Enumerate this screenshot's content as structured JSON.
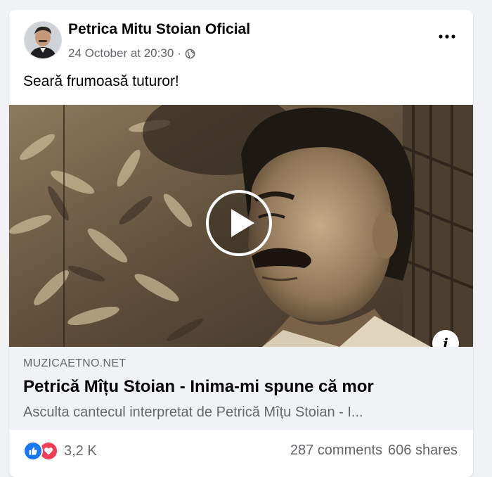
{
  "post": {
    "author": "Petrica Mitu Stoian Oficial",
    "timestamp": "24 October at 20:30",
    "separator": "·",
    "privacy_icon": "globe-icon",
    "more_icon": "more-horizontal-icon",
    "text": "Seară frumoasă tuturor!"
  },
  "media": {
    "play_icon": "play-icon",
    "info_icon": "info-icon",
    "info_label": "i"
  },
  "link_preview": {
    "domain": "MUZICAETNO.NET",
    "title": "Petrică Mîțu Stoian - Inima-mi spune că mor",
    "description": "Asculta cantecul interpretat de Petrică Mîțu Stoian - I..."
  },
  "stats": {
    "reaction_icons": [
      "like-icon",
      "love-icon"
    ],
    "reactions_count": "3,2 K",
    "comments": "287 comments",
    "shares": "606 shares"
  },
  "colors": {
    "like": "#1877f2",
    "love": "#f33e58",
    "secondary_text": "#65676b",
    "primary_text": "#050505",
    "background": "#f0f2f5"
  }
}
